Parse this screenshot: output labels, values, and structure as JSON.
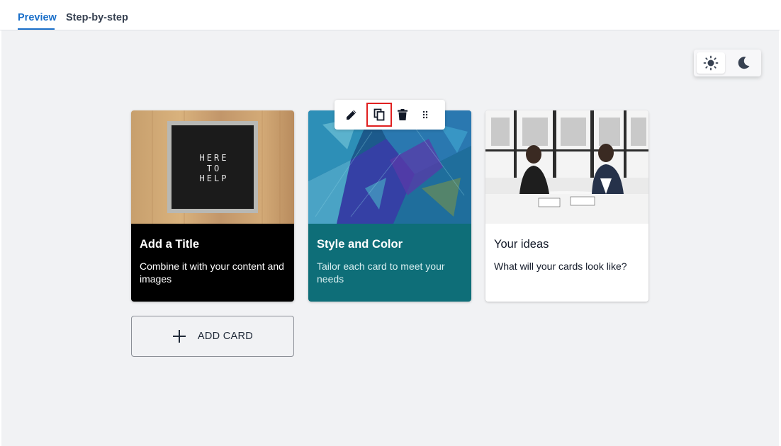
{
  "tabs": [
    {
      "label": "Preview",
      "active": true
    },
    {
      "label": "Step-by-step",
      "active": false
    }
  ],
  "theme_toggle": {
    "options": [
      "sun-icon",
      "moon-icon"
    ],
    "selected": "light"
  },
  "card_toolbar": {
    "icons": [
      "pencil-icon",
      "copy-icon",
      "trash-icon",
      "drag-handle-icon"
    ],
    "highlighted": "copy-icon",
    "highlight_color": "#e02020"
  },
  "cards": [
    {
      "title": "Add a Title",
      "text": "Combine it with your content and images",
      "image_text": "HERE TO HELP",
      "color": "#000000"
    },
    {
      "title": "Style and Color",
      "text": "Tailor each card to meet your needs",
      "color": "#0e6e78"
    },
    {
      "title": "Your ideas",
      "text": "What will your cards look like?",
      "color": "#ffffff"
    }
  ],
  "add_card": {
    "label": "ADD CARD"
  },
  "colors": {
    "accent": "#1a6fc9",
    "canvas": "#f1f2f4"
  }
}
